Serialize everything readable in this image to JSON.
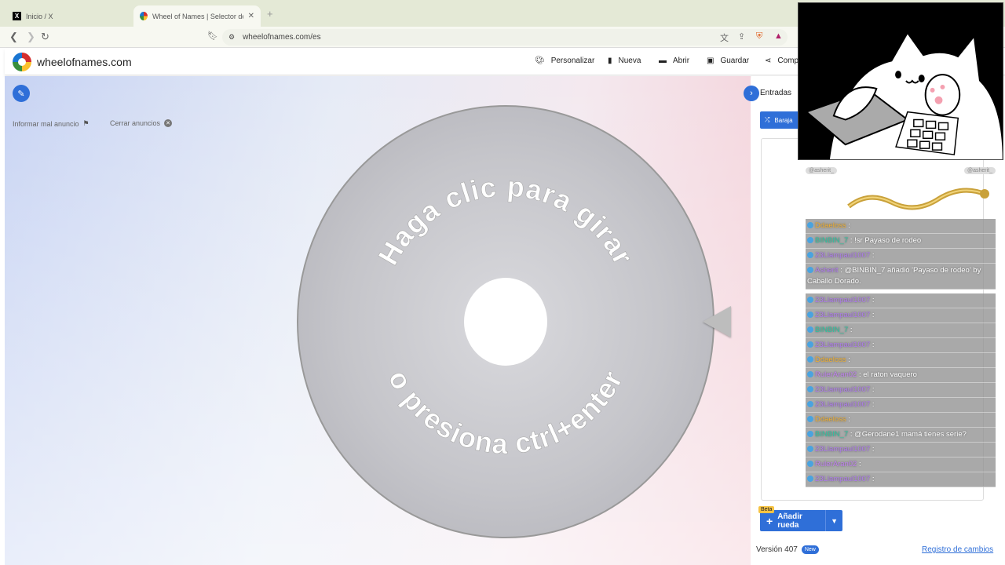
{
  "browser": {
    "tabs": [
      {
        "title": "Inicio / X",
        "favicon": "x-logo-icon"
      },
      {
        "title": "Wheel of Names | Selector de n",
        "favicon": "wheel-logo-icon"
      }
    ],
    "new_tab": "+",
    "url": "wheelofnames.com/es"
  },
  "site": {
    "name": "wheelofnames.com",
    "menu": [
      {
        "label": "Personalizar",
        "icon": "palette-icon"
      },
      {
        "label": "Nueva",
        "icon": "file-icon"
      },
      {
        "label": "Abrir",
        "icon": "folder-icon"
      },
      {
        "label": "Guardar",
        "icon": "save-icon"
      },
      {
        "label": "Comp",
        "icon": "share-icon"
      }
    ]
  },
  "main": {
    "report_ad": "Informar mal anuncio",
    "close_ads": "Cerrar anuncios",
    "wheel": {
      "line1": "Haga clic para girar",
      "line2": "o presiona ctrl+enter",
      "color": "#c8c8cc"
    }
  },
  "panel": {
    "tab": "Entradas",
    "shuffle": "Baraja",
    "beta": "Beta",
    "add_wheel": "Añadir rueda",
    "version": "Versión 407",
    "new_badge": "New",
    "changelog": "Registro de cambios"
  },
  "chat": {
    "header_left": "@asherit_",
    "header_right": "@asherit_",
    "messages": [
      {
        "user": "Ddaeloss",
        "color": "#f0b030",
        "text": ":"
      },
      {
        "user": "BINBIN_7",
        "color": "#2ec4a0",
        "text": ": !sr Payaso de rodeo"
      },
      {
        "user": "23Llampaul1007",
        "color": "#b07af0",
        "text": ":"
      },
      {
        "user": "Asherit",
        "color": "#b07af0",
        "text": ": @BINBIN_7 añadió 'Payaso de rodeo' by Caballo Dorado."
      },
      {
        "user": "23Llampaul1007",
        "color": "#b07af0",
        "text": ":"
      },
      {
        "user": "23Llampaul1007",
        "color": "#b07af0",
        "text": ":"
      },
      {
        "user": "BINBIN_7",
        "color": "#2ec4a0",
        "text": ":"
      },
      {
        "user": "23Llampaul1007",
        "color": "#b07af0",
        "text": ":"
      },
      {
        "user": "Ddaeloss",
        "color": "#f0b030",
        "text": ":"
      },
      {
        "user": "RulerAran02",
        "color": "#c080f0",
        "text": ": el raton vaquero"
      },
      {
        "user": "23Llampaul1007",
        "color": "#b07af0",
        "text": ":"
      },
      {
        "user": "23Llampaul1007",
        "color": "#b07af0",
        "text": ":"
      },
      {
        "user": "Ddaeloss",
        "color": "#f0b030",
        "text": ":"
      },
      {
        "user": "BINBIN_7",
        "color": "#2ec4a0",
        "text": ": @Gerodane1 mamá tienes serie?"
      },
      {
        "user": "23Llampaul1007",
        "color": "#b07af0",
        "text": ":"
      },
      {
        "user": "RulerAran02",
        "color": "#c080f0",
        "text": ":"
      },
      {
        "user": "23Llampaul1007",
        "color": "#b07af0",
        "text": ":"
      }
    ]
  }
}
